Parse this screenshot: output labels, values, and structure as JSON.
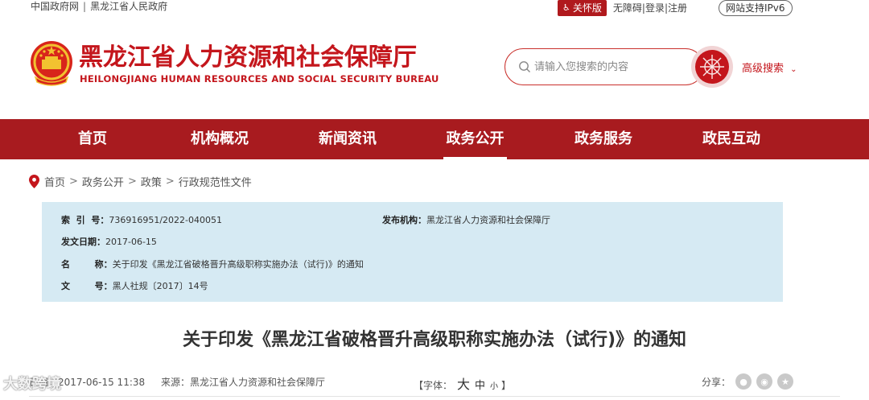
{
  "topbar": {
    "links_left": [
      "中国政府网",
      "黑龙江省人民政府"
    ],
    "separator": "|",
    "care_label": "关怀版",
    "links_right": [
      "无障碍",
      "登录",
      "注册"
    ],
    "ipv6_label": "网站支持IPv6"
  },
  "header": {
    "title": "黑龙江省人力资源和社会保障厅",
    "subtitle": "HEILONGJIANG HUMAN RESOURCES AND SOCIAL SECURITY BUREAU",
    "search_placeholder": "请输入您搜索的内容",
    "advanced_search": "高级搜索"
  },
  "nav": {
    "items": [
      {
        "label": "首页"
      },
      {
        "label": "机构概况"
      },
      {
        "label": "新闻资讯"
      },
      {
        "label": "政务公开",
        "active": true
      },
      {
        "label": "政务服务"
      },
      {
        "label": "政民互动"
      }
    ]
  },
  "breadcrumb": [
    "首页",
    "政务公开",
    "政策",
    "行政规范性文件"
  ],
  "breadcrumb_sep": ">",
  "info": {
    "index_key": "索  引  号：",
    "index_val": "736916951/2022-040051",
    "org_key": "发布机构：",
    "org_val": "黑龙江省人力资源和社会保障厅",
    "date_key": "发文日期：",
    "date_val": "2017-06-15",
    "name_key": "名        称：",
    "name_val": "关于印发《黑龙江省破格晋升高级职称实施办法（试行)》的通知",
    "num_key": "文        号：",
    "num_val": "黑人社规〔2017〕14号"
  },
  "doc": {
    "title": "关于印发《黑龙江省破格晋升高级职称实施办法（试行)》的通知"
  },
  "meta": {
    "date_partial": "日期：2017-06-15 11:38",
    "source": "来源：黑龙江省人力资源和社会保障厅",
    "font_label": "【字体：",
    "font_big": "大",
    "font_mid": "中",
    "font_small": "小",
    "font_close": "】",
    "share_label": "分享："
  },
  "watermark": "大数跨境",
  "colors": {
    "brand_red": "#c4161c",
    "nav_red": "#a81b1f",
    "info_bg": "#d6eaf3"
  }
}
